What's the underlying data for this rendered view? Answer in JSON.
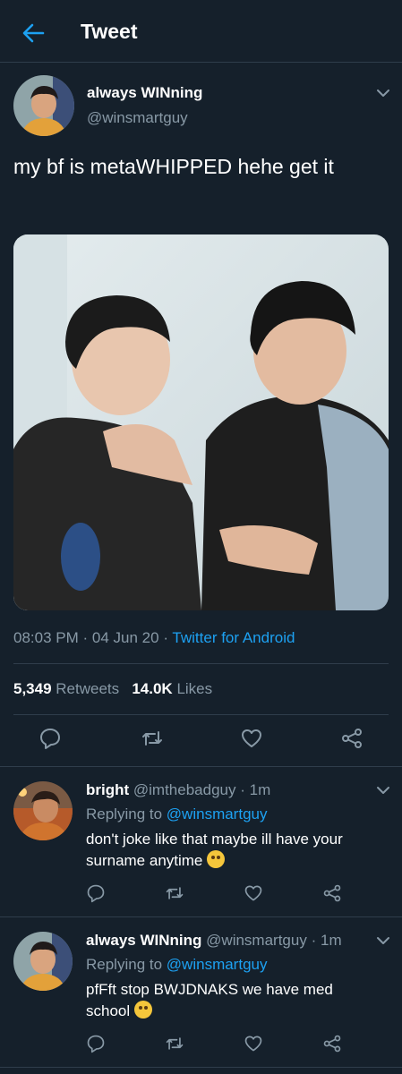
{
  "header": {
    "title": "Tweet"
  },
  "tweet": {
    "author_name": "always WINning",
    "author_handle": "@winsmartguy",
    "text": "my bf is metaWHIPPED hehe get it",
    "time": "08:03 PM",
    "date": "04 Jun 20",
    "source": "Twitter for Android",
    "retweets_count": "5,349",
    "retweets_label": "Retweets",
    "likes_count": "14.0K",
    "likes_label": "Likes"
  },
  "replies": [
    {
      "author_name": "bright",
      "author_handle": "@imthebadguy",
      "age": "1m",
      "replying_prefix": "Replying to",
      "replying_to": "@winsmartguy",
      "text": "don't joke like that maybe ill have your surname anytime",
      "emoji": "flushed-face-emoji"
    },
    {
      "author_name": "always WINning",
      "author_handle": "@winsmartguy",
      "age": "1m",
      "replying_prefix": "Replying to",
      "replying_to": "@winsmartguy",
      "text": "pfFft stop BWJDNAKS we have med school",
      "emoji": "tongue-face-emoji"
    }
  ],
  "colors": {
    "background": "#15202b",
    "accent": "#1da1f2",
    "muted": "#8899a6",
    "divider": "#2f3d4b"
  },
  "icons": [
    "back-arrow-icon",
    "chevron-down-icon",
    "reply-icon",
    "retweet-icon",
    "like-icon",
    "share-icon"
  ]
}
